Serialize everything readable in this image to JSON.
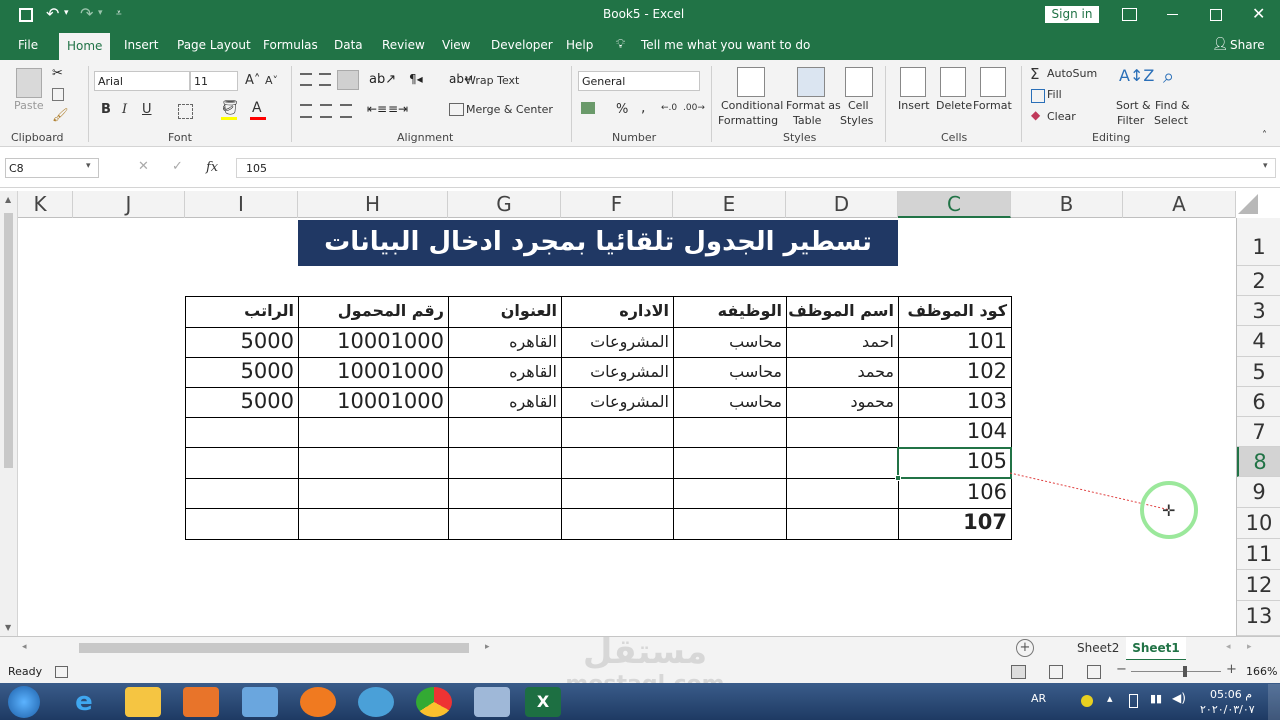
{
  "app": {
    "doc_title": "Book5 - Excel",
    "sign_in": "Sign in"
  },
  "tabs": [
    "File",
    "Home",
    "Insert",
    "Page Layout",
    "Formulas",
    "Data",
    "Review",
    "View",
    "Developer",
    "Help"
  ],
  "tell_me": "Tell me what you want to do",
  "share": "Share",
  "ribbon": {
    "paste": "Paste",
    "font_name": "Arial",
    "font_size": "11",
    "bold": "B",
    "italic": "I",
    "underline": "U",
    "wrap_text": "Wrap Text",
    "merge_center": "Merge & Center",
    "number_format": "General",
    "percent": "%",
    "comma": ",",
    "conditional_1": "Conditional",
    "conditional_2": "Formatting",
    "format_as_1": "Format as",
    "format_as_2": "Table",
    "cell_styles_1": "Cell",
    "cell_styles_2": "Styles",
    "insert": "Insert",
    "delete": "Delete",
    "format": "Format",
    "autosum": "AutoSum",
    "fill": "Fill",
    "clear": "Clear",
    "sort_1": "Sort &",
    "sort_2": "Filter",
    "find_1": "Find &",
    "find_2": "Select",
    "groups": {
      "clipboard": "Clipboard",
      "font": "Font",
      "alignment": "Alignment",
      "number": "Number",
      "styles": "Styles",
      "cells": "Cells",
      "editing": "Editing"
    }
  },
  "formula_bar": {
    "name_box": "C8",
    "fx": "fx",
    "value": "105"
  },
  "columns": [
    "K",
    "J",
    "I",
    "H",
    "G",
    "F",
    "E",
    "D",
    "C",
    "B",
    "A"
  ],
  "rows": [
    "1",
    "2",
    "3",
    "4",
    "5",
    "6",
    "7",
    "8",
    "9",
    "10",
    "11",
    "12",
    "13"
  ],
  "banner": "تسطير الجدول تلقائيا بمجرد ادخال البيانات",
  "table": {
    "headers": [
      "كود الموظف",
      "اسم الموظف",
      "الوظيفه",
      "الاداره",
      "العنوان",
      "رقم المحمول",
      "الراتب"
    ],
    "rows": [
      [
        "101",
        "احمد",
        "محاسب",
        "المشروعات",
        "القاهره",
        "10001000",
        "5000"
      ],
      [
        "102",
        "محمد",
        "محاسب",
        "المشروعات",
        "القاهره",
        "10001000",
        "5000"
      ],
      [
        "103",
        "محمود",
        "محاسب",
        "المشروعات",
        "القاهره",
        "10001000",
        "5000"
      ],
      [
        "104",
        "",
        "",
        "",
        "",
        "",
        ""
      ],
      [
        "105",
        "",
        "",
        "",
        "",
        "",
        ""
      ],
      [
        "106",
        "",
        "",
        "",
        "",
        "",
        ""
      ],
      [
        "107",
        "",
        "",
        "",
        "",
        "",
        ""
      ]
    ]
  },
  "sheets": [
    "Sheet2",
    "Sheet1"
  ],
  "status": {
    "ready": "Ready",
    "zoom": "166%"
  },
  "taskbar": {
    "lang": "AR",
    "time": "05:06 م",
    "date": "٢٠٢٠/٠٣/٠٧"
  },
  "watermark": {
    "text_ar": "مستقل",
    "text_en": "mostaql.com"
  }
}
